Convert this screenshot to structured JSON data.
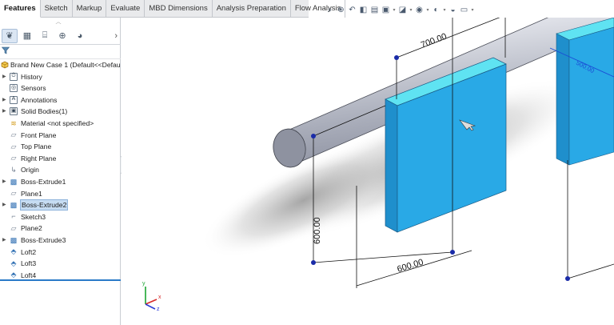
{
  "command_tabs": [
    {
      "label": "Features",
      "active": true
    },
    {
      "label": "Sketch"
    },
    {
      "label": "Markup"
    },
    {
      "label": "Evaluate"
    },
    {
      "label": "MBD Dimensions"
    },
    {
      "label": "Analysis Preparation"
    },
    {
      "label": "Flow Analysis"
    }
  ],
  "view_toolbar": [
    "zoom-to-fit-icon",
    "zoom-to-area-icon",
    "previous-view-icon",
    "section-view-icon",
    "dynamic-annotation-icon",
    "view-orientation-icon",
    "display-style-icon",
    "hide-show-items-icon",
    "edit-appearance-icon",
    "apply-scene-icon",
    "view-settings-icon"
  ],
  "feature_manager": {
    "tabs": [
      "feature-manager-icon",
      "property-manager-icon",
      "configuration-manager-icon",
      "dimxpert-icon",
      "display-manager-icon"
    ],
    "root": "Brand New Case 1  (Default<<Defau",
    "items": [
      {
        "label": "History",
        "icon": "history-icon",
        "expand": true
      },
      {
        "label": "Sensors",
        "icon": "sensors-icon"
      },
      {
        "label": "Annotations",
        "icon": "annotations-icon",
        "expand": true
      },
      {
        "label": "Solid Bodies(1)",
        "icon": "solid-bodies-icon",
        "expand": true
      },
      {
        "label": "Material <not specified>",
        "icon": "material-icon"
      },
      {
        "label": "Front Plane",
        "icon": "plane-icon"
      },
      {
        "label": "Top Plane",
        "icon": "plane-icon"
      },
      {
        "label": "Right Plane",
        "icon": "plane-icon"
      },
      {
        "label": "Origin",
        "icon": "origin-icon"
      },
      {
        "label": "Boss-Extrude1",
        "icon": "extrude-icon",
        "expand": true
      },
      {
        "label": "Plane1",
        "icon": "plane-icon"
      },
      {
        "label": "Boss-Extrude2",
        "icon": "extrude-icon",
        "expand": true,
        "selected": true
      },
      {
        "label": "Sketch3",
        "icon": "sketch-icon"
      },
      {
        "label": "Plane2",
        "icon": "plane-icon"
      },
      {
        "label": "Boss-Extrude3",
        "icon": "extrude-icon",
        "expand": true
      },
      {
        "label": "Loft2",
        "icon": "loft-icon"
      },
      {
        "label": "Loft3",
        "icon": "loft-icon"
      },
      {
        "label": "Loft4",
        "icon": "loft-icon"
      }
    ]
  },
  "graphics": {
    "dimensions": [
      "700.00",
      "600.00",
      "600.00",
      "500.00"
    ],
    "triad": {
      "x": "x",
      "y": "y",
      "z": "z"
    },
    "colors": {
      "plate_face": "#29a9e6",
      "plate_top": "#5fe3f2",
      "plate_side": "#1f8fcc",
      "cylinder": "#c9ccd6",
      "dimension": "#111111",
      "handle": "#1a2ba8"
    }
  }
}
